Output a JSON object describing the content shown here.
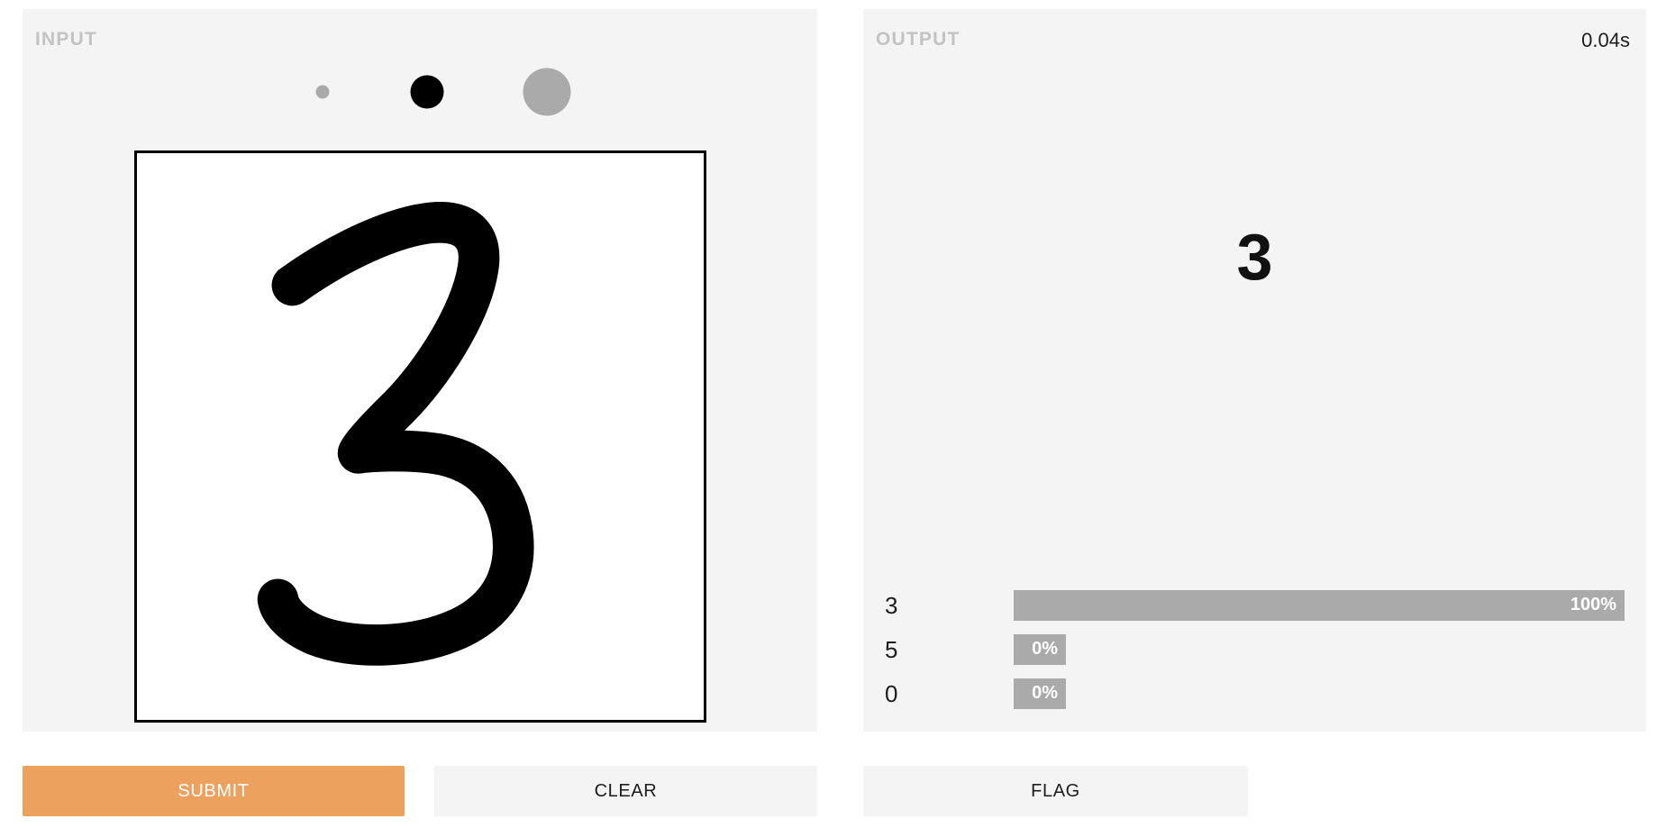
{
  "input_panel": {
    "label": "INPUT",
    "brush_sizes": [
      {
        "name": "small",
        "selected": false,
        "color": "#aaaaaa"
      },
      {
        "name": "medium",
        "selected": true,
        "color": "#000000"
      },
      {
        "name": "large",
        "selected": false,
        "color": "#aaaaaa"
      }
    ],
    "canvas": {
      "drawn_digit": "3",
      "stroke_color": "#000000",
      "background": "#ffffff"
    }
  },
  "output_panel": {
    "label": "OUTPUT",
    "duration": "0.04s",
    "prediction": "3",
    "confidences": [
      {
        "label": "3",
        "percent": "100%",
        "value": 100
      },
      {
        "label": "5",
        "percent": "0%",
        "value": 0
      },
      {
        "label": "0",
        "percent": "0%",
        "value": 0
      }
    ]
  },
  "buttons": {
    "submit": "SUBMIT",
    "clear": "CLEAR",
    "flag": "FLAG"
  },
  "colors": {
    "accent": "#eca25e",
    "panel": "#f4f4f4",
    "bar": "#aaaaaa",
    "muted_label": "#c3c3c3"
  }
}
